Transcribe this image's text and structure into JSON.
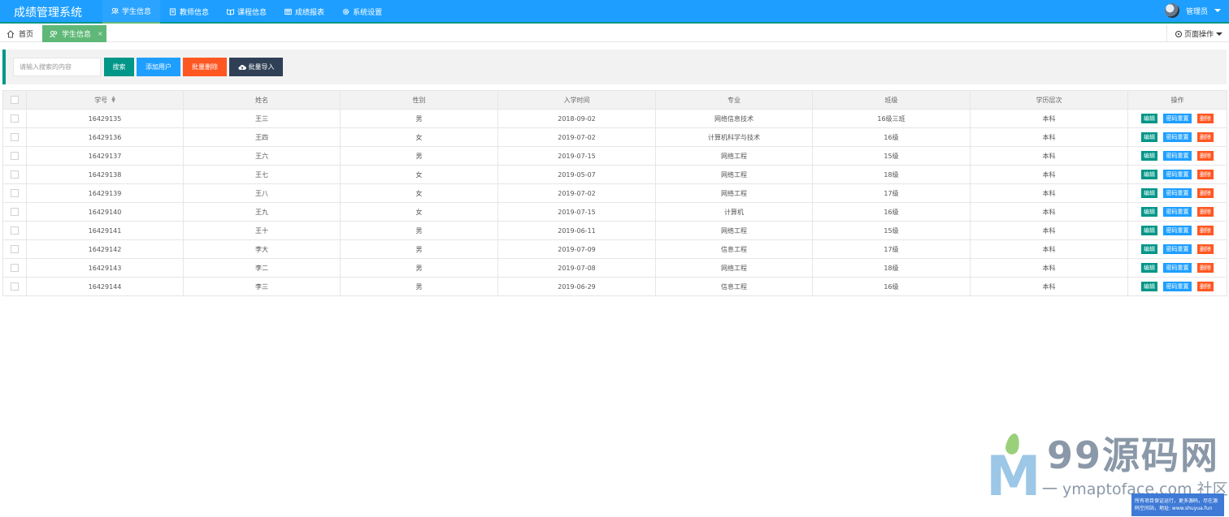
{
  "app": {
    "title": "成绩管理系统"
  },
  "nav": [
    {
      "label": "学生信息",
      "icon": "users-icon"
    },
    {
      "label": "教师信息",
      "icon": "note-icon"
    },
    {
      "label": "课程信息",
      "icon": "book-icon"
    },
    {
      "label": "成绩报表",
      "icon": "table-icon"
    },
    {
      "label": "系统设置",
      "icon": "gear-icon"
    }
  ],
  "user": {
    "name": "管理员"
  },
  "tabs": {
    "home": "首页",
    "active": "学生信息",
    "close": "×",
    "page_ops": "页面操作"
  },
  "search": {
    "placeholder": "请输入搜索的内容",
    "search_label": "搜索",
    "add_label": "添加用户",
    "batch_delete_label": "批量删除",
    "batch_import_label": "批量导入"
  },
  "table": {
    "columns": [
      "学号",
      "姓名",
      "性别",
      "入学时间",
      "专业",
      "班级",
      "学历层次",
      "操作"
    ],
    "rows": [
      [
        "16429135",
        "王三",
        "男",
        "2018-09-02",
        "网络信息技术",
        "16级三班",
        "本科"
      ],
      [
        "16429136",
        "王四",
        "女",
        "2019-07-02",
        "计算机科学与技术",
        "16级",
        "本科"
      ],
      [
        "16429137",
        "王六",
        "男",
        "2019-07-15",
        "网络工程",
        "15级",
        "本科"
      ],
      [
        "16429138",
        "王七",
        "女",
        "2019-05-07",
        "网络工程",
        "18级",
        "本科"
      ],
      [
        "16429139",
        "王八",
        "女",
        "2019-07-02",
        "网络工程",
        "17级",
        "本科"
      ],
      [
        "16429140",
        "王九",
        "女",
        "2019-07-15",
        "计算机",
        "16级",
        "本科"
      ],
      [
        "16429141",
        "王十",
        "男",
        "2019-06-11",
        "网络工程",
        "15级",
        "本科"
      ],
      [
        "16429142",
        "李大",
        "男",
        "2019-07-09",
        "信息工程",
        "17级",
        "本科"
      ],
      [
        "16429143",
        "李二",
        "男",
        "2019-07-08",
        "网络工程",
        "18级",
        "本科"
      ],
      [
        "16429144",
        "李三",
        "男",
        "2019-06-29",
        "信息工程",
        "16级",
        "本科"
      ]
    ],
    "row_actions": {
      "edit": "编辑",
      "reset": "密码重置",
      "delete": "删除"
    }
  },
  "watermark": {
    "title": "99源码网",
    "subtitle": "一 ymaptoface.com 社区",
    "note": "所有项目保证运行，更多源码，尽在源码空间站，地址: www.shuyua.fun"
  },
  "colors": {
    "header": "#1e9fff",
    "accent": "#009688",
    "active_tab": "#5fb878",
    "danger": "#ff5722",
    "dark": "#2f4056"
  }
}
